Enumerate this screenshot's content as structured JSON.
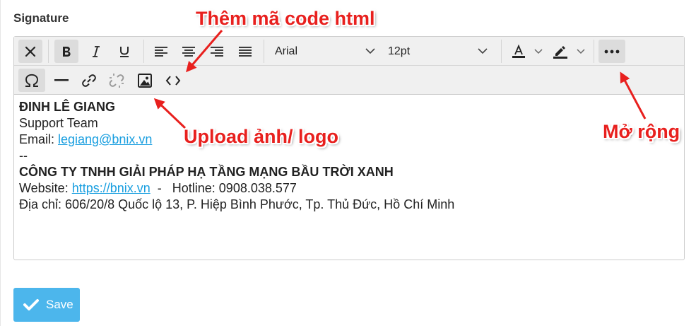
{
  "section": {
    "title": "Signature"
  },
  "toolbar": {
    "font_family": "Arial",
    "font_size": "12pt",
    "icons": [
      "close-icon",
      "bold-icon",
      "italic-icon",
      "underline-icon",
      "align-left-icon",
      "align-center-icon",
      "align-right-icon",
      "align-justify-icon",
      "text-color-icon",
      "highlight-icon",
      "more-icon",
      "omega-icon",
      "horizontal-rule-icon",
      "link-icon",
      "unlink-icon",
      "image-icon",
      "code-icon"
    ]
  },
  "signature": {
    "name": "ĐINH LÊ GIANG",
    "role": "Support Team",
    "email_label": "Email: ",
    "email": "legiang@bnix.vn",
    "divider": "--",
    "company": "CÔNG TY TNHH GIẢI PHÁP HẠ TẦNG MẠNG BẦU TRỜI XANH",
    "website_label": "Website: ",
    "website": "https://bnix.vn",
    "hotline": "  -   Hotline: 0908.038.577",
    "address": "Địa chỉ: 606/20/8 Quốc lộ 13, P. Hiệp Bình Phước, Tp. Thủ Đức, Hồ Chí Minh"
  },
  "save_button": {
    "label": "Save"
  },
  "annotations": {
    "html_code": "Thêm mã code html",
    "upload": "Upload ảnh/ logo",
    "expand": "Mở rộng",
    "color": "#e8201e"
  },
  "colors": {
    "link": "#1a9fe0",
    "save": "#4cb6ec",
    "toolbar_bg": "#f0f0f0"
  }
}
